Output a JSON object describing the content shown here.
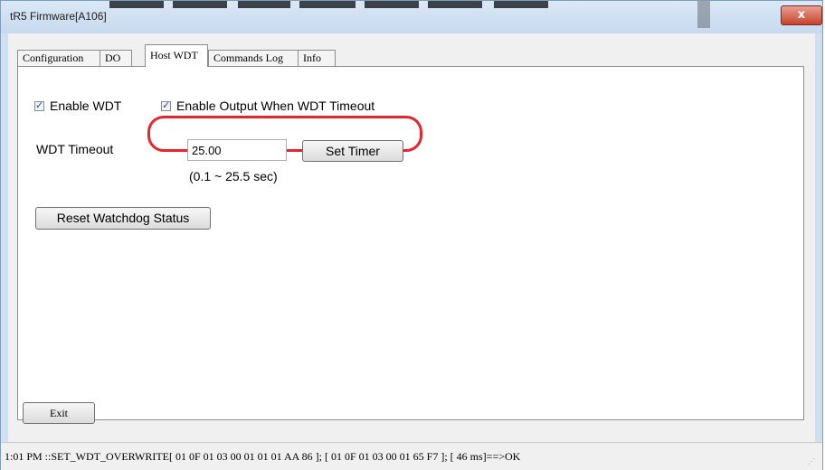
{
  "window": {
    "title": "tR5 Firmware[A106]",
    "close_glyph": "x"
  },
  "tabs": [
    {
      "label": "Configuration"
    },
    {
      "label": "DO"
    },
    {
      "label": "Host WDT"
    },
    {
      "label": "Commands Log"
    },
    {
      "label": "Info"
    }
  ],
  "active_tab": "Host WDT",
  "host_wdt": {
    "enable_wdt": {
      "label": "Enable WDT",
      "checked": true
    },
    "enable_output": {
      "label": "Enable Output When WDT Timeout",
      "checked": true
    },
    "timeout_label": "WDT Timeout",
    "timeout_value": "25.00",
    "set_timer_label": "Set Timer",
    "range_hint": "(0.1 ~ 25.5 sec)",
    "reset_label": "Reset Watchdog Status"
  },
  "exit_label": "Exit",
  "status_text": "1:01 PM ::SET_WDT_OVERWRITE[ 01 0F 01 03 00 01 01 01 AA 86 ]; [ 01 0F 01 03 00 01 65 F7 ]; [ 46 ms]==>OK",
  "colors": {
    "highlight": "#e8242d",
    "titlebar": "#cfe0f2",
    "close": "#c7432b"
  }
}
